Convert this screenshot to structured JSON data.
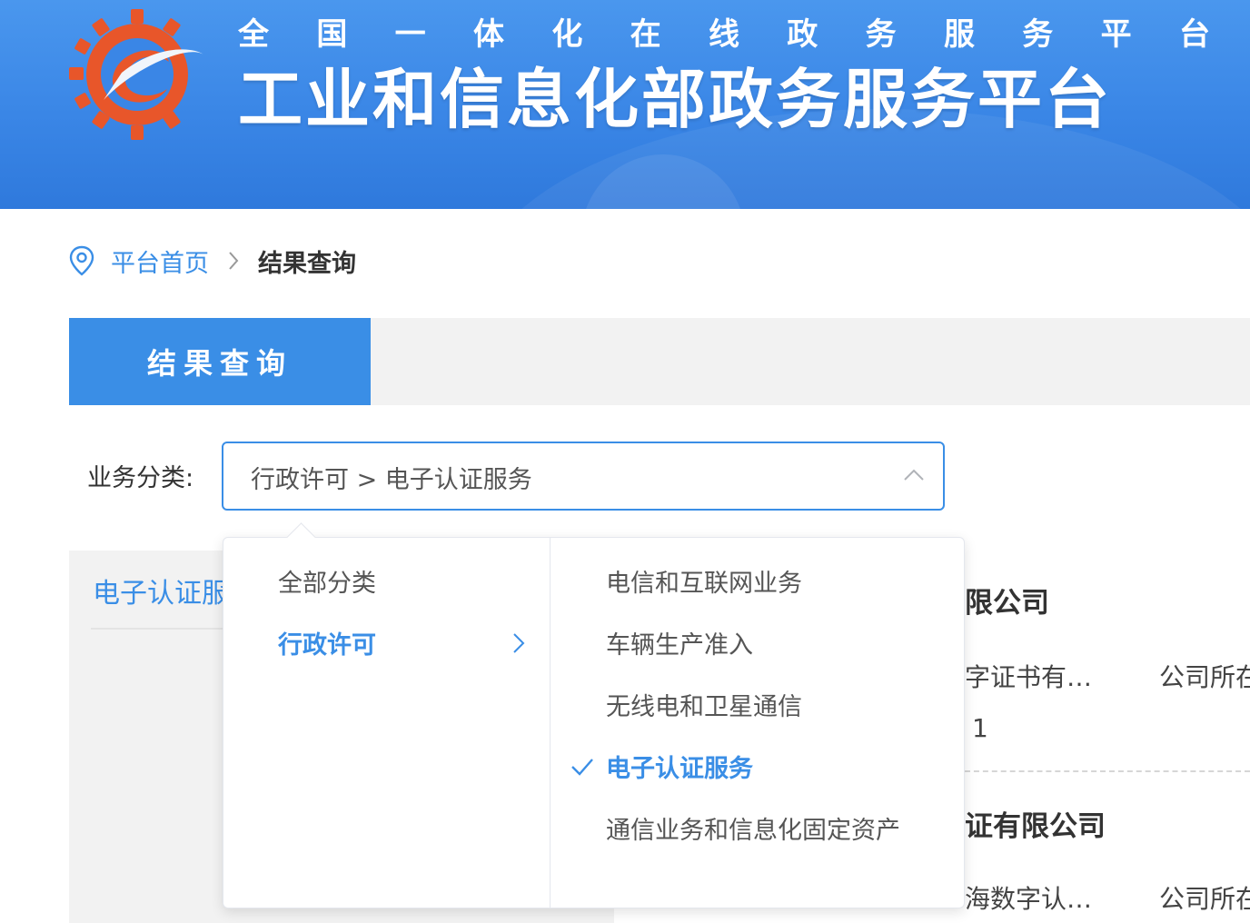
{
  "header": {
    "subtitle_chars": [
      "全",
      "国",
      "一",
      "体",
      "化",
      "在",
      "线",
      "政",
      "务",
      "服",
      "务",
      "平",
      "台"
    ],
    "title": "工业和信息化部政务服务平台"
  },
  "breadcrumb": {
    "home": "平台首页",
    "current": "结果查询"
  },
  "tabs": {
    "active": "结果查询"
  },
  "filter": {
    "label": "业务分类:",
    "value": "行政许可 > 电子认证服务"
  },
  "dropdown": {
    "level1": [
      {
        "label": "全部分类",
        "active": false
      },
      {
        "label": "行政许可",
        "active": true
      }
    ],
    "level2": [
      {
        "label": "电信和互联网业务",
        "active": false
      },
      {
        "label": "车辆生产准入",
        "active": false
      },
      {
        "label": "无线电和卫星通信",
        "active": false
      },
      {
        "label": "电子认证服务",
        "active": true
      },
      {
        "label": "通信业务和信息化固定资产",
        "active": false
      }
    ]
  },
  "background": {
    "left_category": "电子认证服",
    "result1": {
      "title": "限公司",
      "field_a": "字证书有…",
      "field_b": "公司所在",
      "field_c": "1"
    },
    "result2": {
      "title": "证有限公司",
      "field_a": "海数字认…",
      "field_b": "公司所在"
    }
  },
  "colors": {
    "primary": "#3a8ee6",
    "banner": "#3a86e6",
    "logo_orange": "#e8562a"
  }
}
